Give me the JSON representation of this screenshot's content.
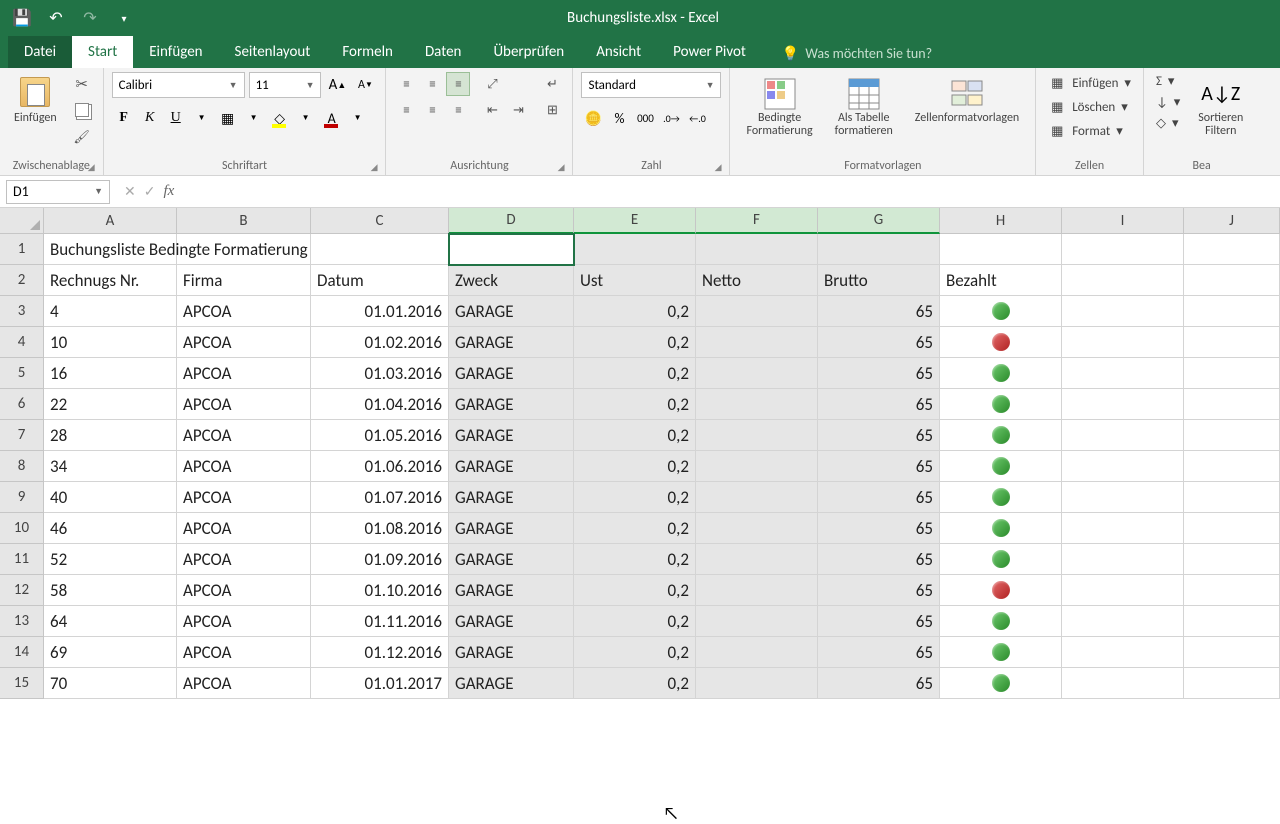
{
  "window": {
    "title": "Buchungsliste.xlsx - Excel"
  },
  "tabs": {
    "file": "Datei",
    "list": [
      "Start",
      "Einfügen",
      "Seitenlayout",
      "Formeln",
      "Daten",
      "Überprüfen",
      "Ansicht",
      "Power Pivot"
    ],
    "active": "Start",
    "tell_me": "Was möchten Sie tun?"
  },
  "ribbon": {
    "clipboard": {
      "paste": "Einfügen",
      "group": "Zwischenablage"
    },
    "font": {
      "name": "Calibri",
      "size": "11",
      "group": "Schriftart"
    },
    "alignment": {
      "group": "Ausrichtung"
    },
    "number": {
      "format": "Standard",
      "group": "Zahl"
    },
    "styles": {
      "cond_format": "Bedingte\nFormatierung",
      "as_table": "Als Tabelle\nformatieren",
      "cell_styles": "Zellenformatvorlagen",
      "group": "Formatvorlagen"
    },
    "cells": {
      "insert": "Einfügen",
      "delete": "Löschen",
      "format": "Format",
      "group": "Zellen"
    },
    "editing": {
      "sort": "Sortieren\nFiltern",
      "group": "Bea"
    }
  },
  "name_box": "D1",
  "columns": [
    "A",
    "B",
    "C",
    "D",
    "E",
    "F",
    "G",
    "H",
    "I",
    "J"
  ],
  "selected_cols": [
    "D",
    "E",
    "F",
    "G"
  ],
  "title_cell": "Buchungsliste Bedingte Formatierung",
  "headers": {
    "a": "Rechnugs Nr.",
    "b": "Firma",
    "c": "Datum",
    "d": "Zweck",
    "e": "Ust",
    "f": "Netto",
    "g": "Brutto",
    "h": "Bezahlt"
  },
  "rows": [
    {
      "nr": "4",
      "firma": "APCOA",
      "datum": "01.01.2016",
      "zweck": "GARAGE",
      "ust": "0,2",
      "brutto": "65",
      "bezahlt": "green"
    },
    {
      "nr": "10",
      "firma": "APCOA",
      "datum": "01.02.2016",
      "zweck": "GARAGE",
      "ust": "0,2",
      "brutto": "65",
      "bezahlt": "red"
    },
    {
      "nr": "16",
      "firma": "APCOA",
      "datum": "01.03.2016",
      "zweck": "GARAGE",
      "ust": "0,2",
      "brutto": "65",
      "bezahlt": "green"
    },
    {
      "nr": "22",
      "firma": "APCOA",
      "datum": "01.04.2016",
      "zweck": "GARAGE",
      "ust": "0,2",
      "brutto": "65",
      "bezahlt": "green"
    },
    {
      "nr": "28",
      "firma": "APCOA",
      "datum": "01.05.2016",
      "zweck": "GARAGE",
      "ust": "0,2",
      "brutto": "65",
      "bezahlt": "green"
    },
    {
      "nr": "34",
      "firma": "APCOA",
      "datum": "01.06.2016",
      "zweck": "GARAGE",
      "ust": "0,2",
      "brutto": "65",
      "bezahlt": "green"
    },
    {
      "nr": "40",
      "firma": "APCOA",
      "datum": "01.07.2016",
      "zweck": "GARAGE",
      "ust": "0,2",
      "brutto": "65",
      "bezahlt": "green"
    },
    {
      "nr": "46",
      "firma": "APCOA",
      "datum": "01.08.2016",
      "zweck": "GARAGE",
      "ust": "0,2",
      "brutto": "65",
      "bezahlt": "green"
    },
    {
      "nr": "52",
      "firma": "APCOA",
      "datum": "01.09.2016",
      "zweck": "GARAGE",
      "ust": "0,2",
      "brutto": "65",
      "bezahlt": "green"
    },
    {
      "nr": "58",
      "firma": "APCOA",
      "datum": "01.10.2016",
      "zweck": "GARAGE",
      "ust": "0,2",
      "brutto": "65",
      "bezahlt": "red"
    },
    {
      "nr": "64",
      "firma": "APCOA",
      "datum": "01.11.2016",
      "zweck": "GARAGE",
      "ust": "0,2",
      "brutto": "65",
      "bezahlt": "green"
    },
    {
      "nr": "69",
      "firma": "APCOA",
      "datum": "01.12.2016",
      "zweck": "GARAGE",
      "ust": "0,2",
      "brutto": "65",
      "bezahlt": "green"
    },
    {
      "nr": "70",
      "firma": "APCOA",
      "datum": "01.01.2017",
      "zweck": "GARAGE",
      "ust": "0,2",
      "brutto": "65",
      "bezahlt": "green"
    }
  ]
}
